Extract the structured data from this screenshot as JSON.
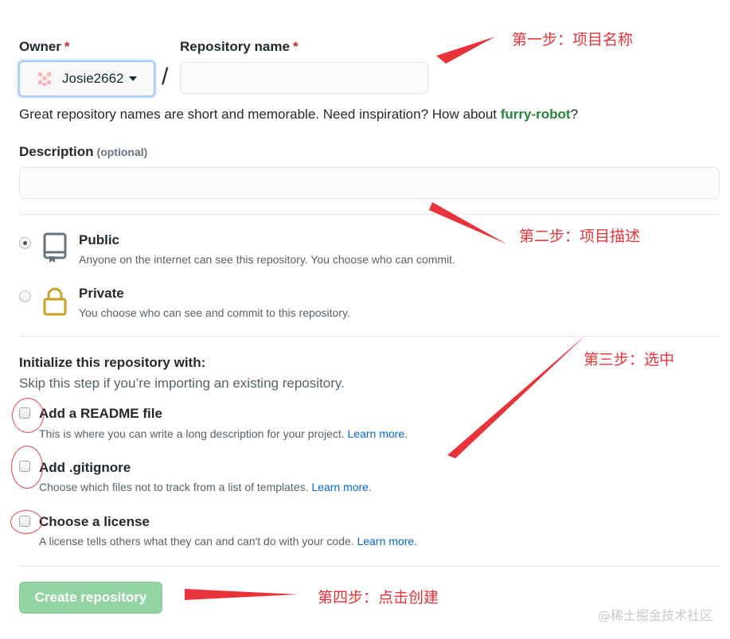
{
  "owner": {
    "label": "Owner",
    "required_mark": "*",
    "value": "Josie2662"
  },
  "repo_name": {
    "label": "Repository name",
    "required_mark": "*",
    "value": "",
    "separator": "/"
  },
  "hint": {
    "prefix": "Great repository names are short and memorable. Need inspiration? How about ",
    "suggestion": "furry-robot",
    "suffix": "?"
  },
  "description": {
    "label": "Description",
    "optional": "(optional)",
    "value": ""
  },
  "visibility": {
    "options": [
      {
        "title": "Public",
        "note": "Anyone on the internet can see this repository. You choose who can commit.",
        "checked": true
      },
      {
        "title": "Private",
        "note": "You choose who can see and commit to this repository.",
        "checked": false
      }
    ]
  },
  "initialize": {
    "title": "Initialize this repository with:",
    "subtitle": "Skip this step if you’re importing an existing repository.",
    "options": [
      {
        "title": "Add a README file",
        "note": "This is where you can write a long description for your project.",
        "link": "Learn more."
      },
      {
        "title": "Add .gitignore",
        "note": "Choose which files not to track from a list of templates.",
        "link": "Learn more."
      },
      {
        "title": "Choose a license",
        "note": "A license tells others what they can and can't do with your code.",
        "link": "Learn more."
      }
    ]
  },
  "create_button": "Create repository",
  "annotations": {
    "step1": "第一步：项目名称",
    "step2": "第二步：项目描述",
    "step3": "第三步：选中",
    "step4": "第四步：点击创建"
  },
  "watermark": "@稀土掘金技术社区",
  "colors": {
    "annotation_red": "#e8333a",
    "suggestion_green": "#22863a",
    "link_blue": "#0366d6",
    "button_green_disabled": "#94d3a2",
    "lock_gold": "#c9a227"
  },
  "icons": {
    "owner_avatar": "identicon-avatar",
    "public": "repo-book-icon",
    "private": "lock-icon",
    "owner_dropdown": "caret-down-icon"
  }
}
